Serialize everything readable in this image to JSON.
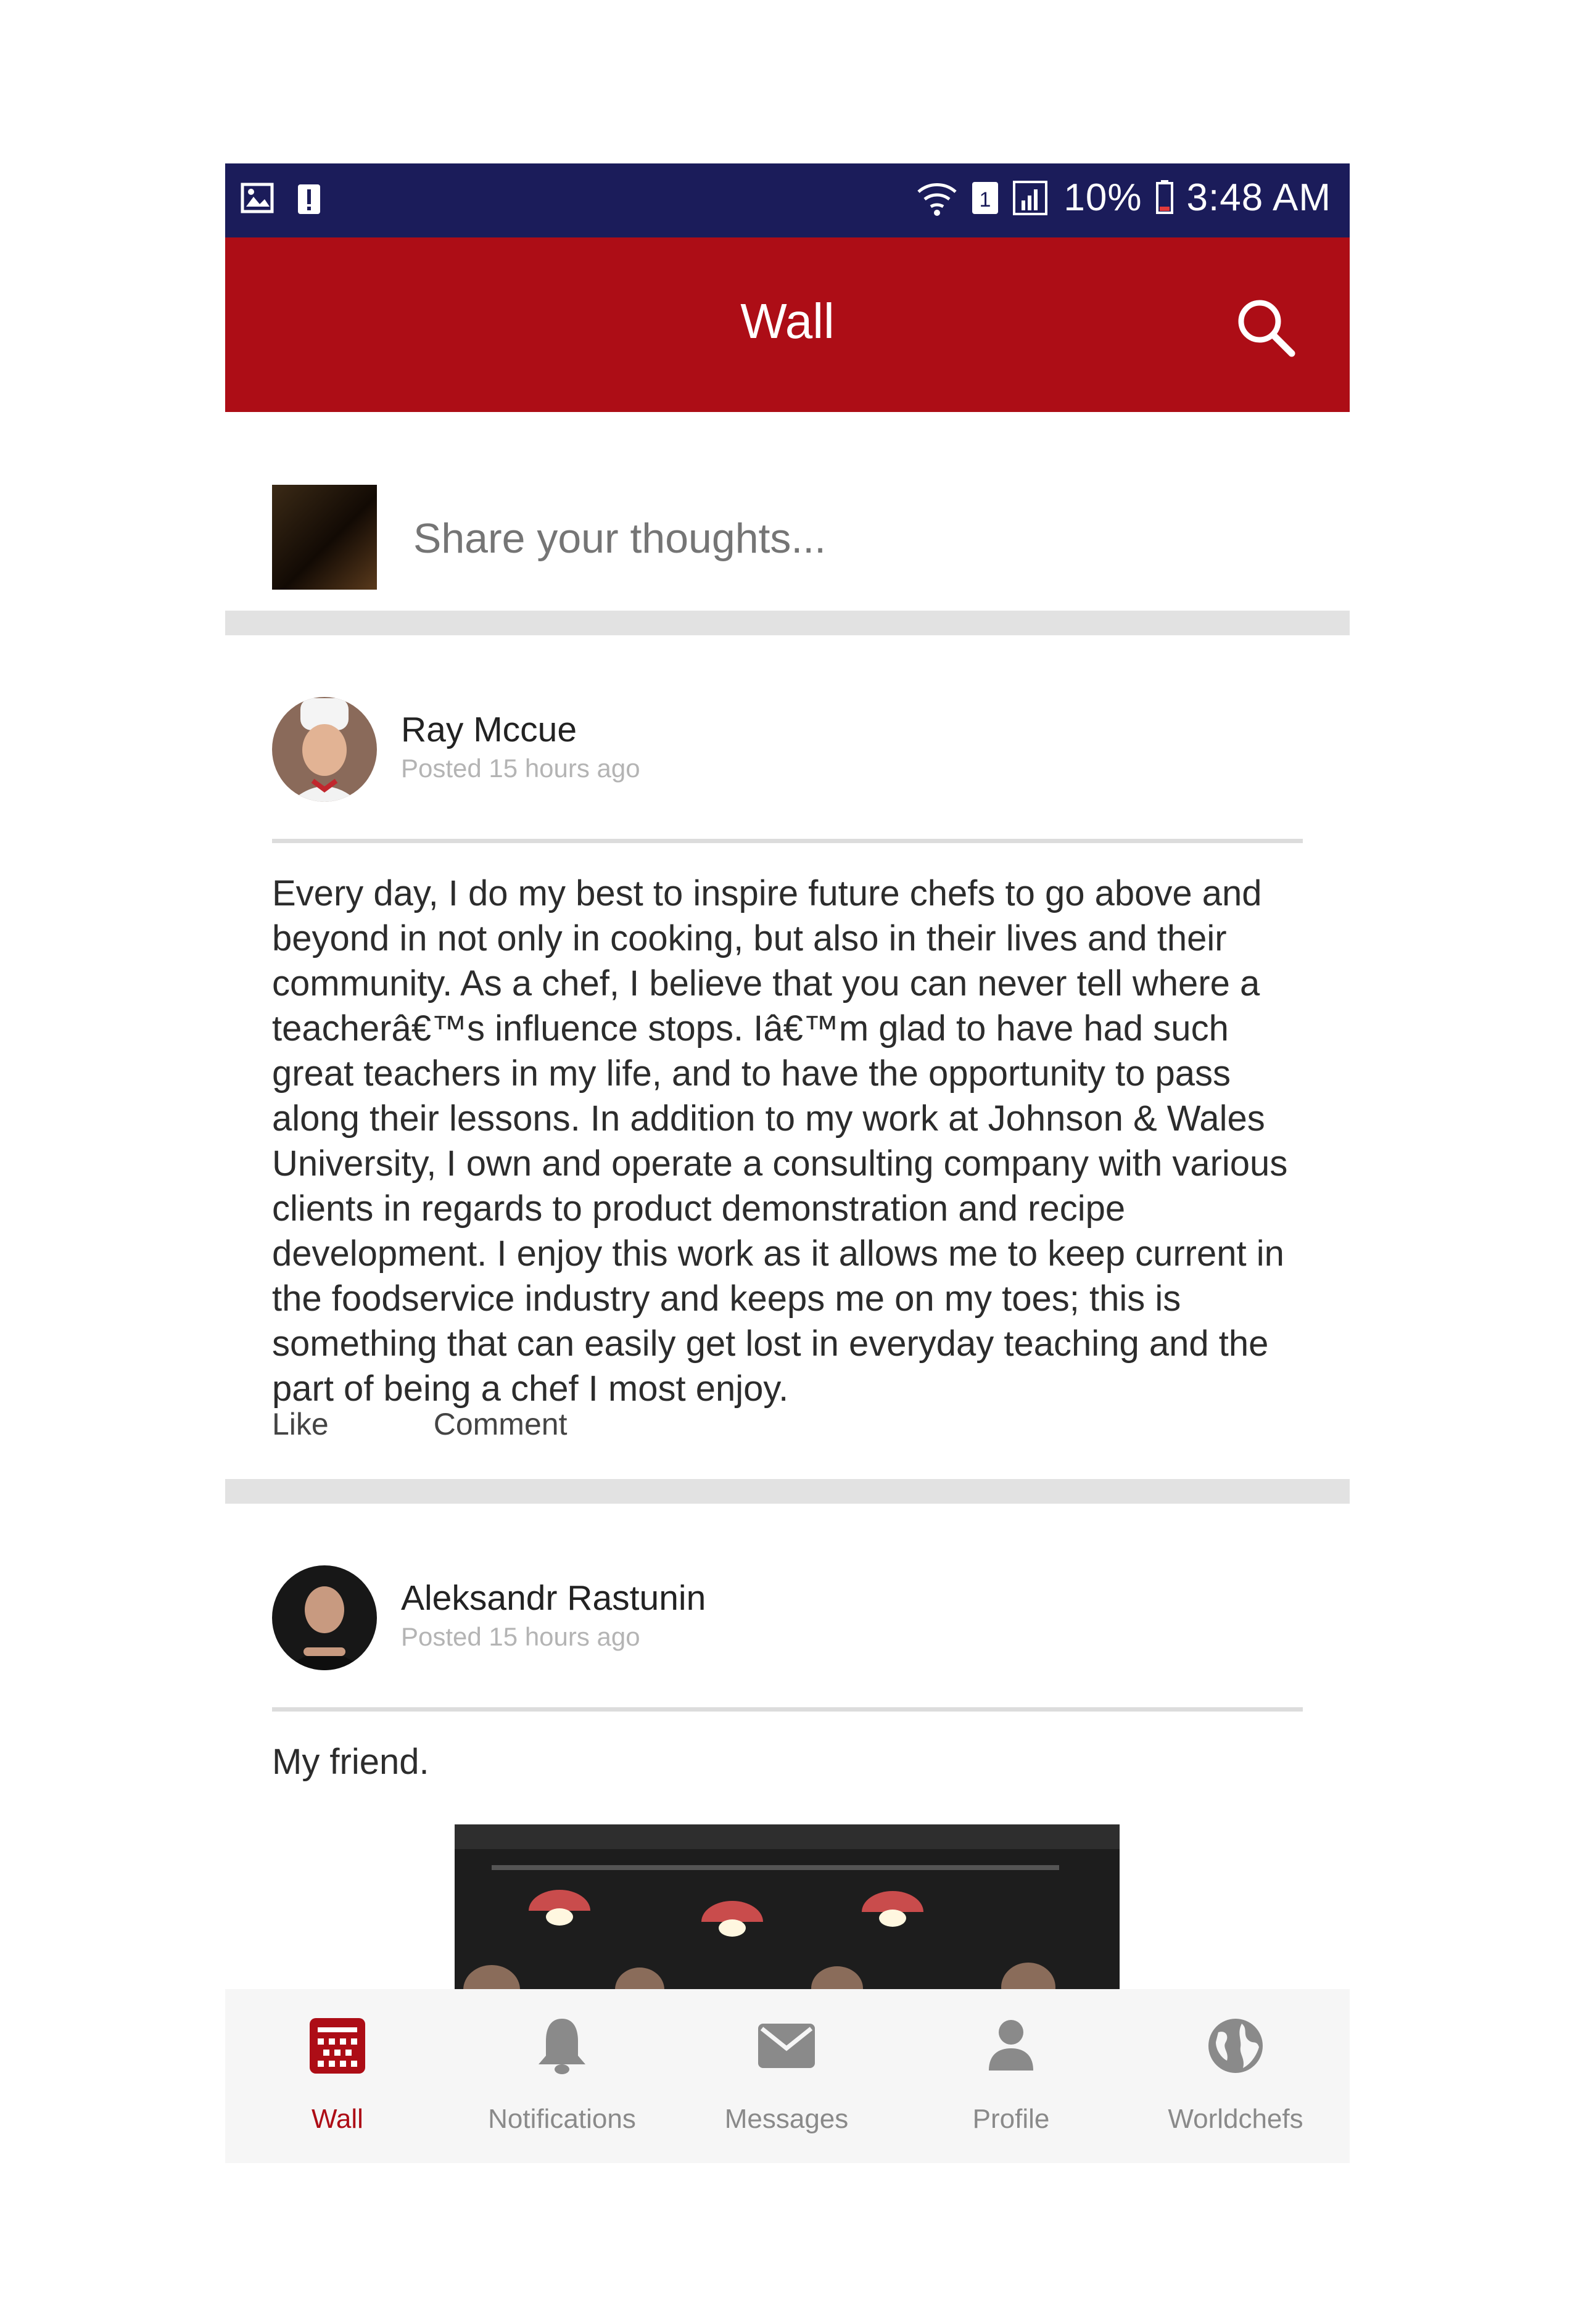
{
  "status_bar": {
    "battery": "10%",
    "time": "3:48 AM",
    "icons": [
      "gallery-icon",
      "alert-icon",
      "wifi-icon",
      "sim-icon",
      "signal-icon",
      "battery-icon"
    ]
  },
  "header": {
    "title": "Wall",
    "search_icon": "search-icon"
  },
  "composer": {
    "placeholder": "Share your thoughts..."
  },
  "posts": [
    {
      "author": "Ray Mccue",
      "time": "Posted 15 hours ago",
      "body": "Every day, I do my best to inspire future chefs to go above and beyond in not only in cooking, but also in their lives and their community. As a chef, I believe that you can never tell where a teacherâ€™s influence stops. Iâ€™m glad to have had such great teachers in my life, and to have the opportunity to pass along their lessons. In addition to my work at Johnson & Wales University, I own and operate a consulting company with various clients in regards to product demonstration and recipe development.  I enjoy this work as it allows me to keep current in the foodservice industry and keeps me on my toes; this is something that can easily get lost in everyday teaching and the part of being a chef I most enjoy.",
      "like_label": "Like",
      "comment_label": "Comment"
    },
    {
      "author": "Aleksandr Rastunin",
      "time": "Posted 15 hours ago",
      "body": "My friend."
    }
  ],
  "bottom_nav": {
    "items": [
      {
        "label": "Wall",
        "icon": "wall-icon",
        "active": true
      },
      {
        "label": "Notifications",
        "icon": "bell-icon",
        "active": false
      },
      {
        "label": "Messages",
        "icon": "envelope-icon",
        "active": false
      },
      {
        "label": "Profile",
        "icon": "person-icon",
        "active": false
      },
      {
        "label": "Worldchefs",
        "icon": "globe-icon",
        "active": false
      }
    ]
  },
  "colors": {
    "status_bar": "#1b1c5a",
    "header": "#ad0d16",
    "active_nav": "#ad0d16",
    "inactive_nav": "#8a8a8a"
  }
}
